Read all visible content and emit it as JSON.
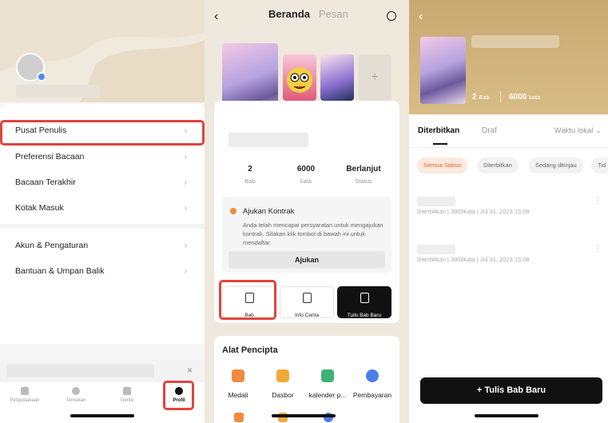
{
  "menu": {
    "items": [
      {
        "label": "Pusat Penulis"
      },
      {
        "label": "Preferensi Bacaan"
      },
      {
        "label": "Bacaan Terakhir"
      },
      {
        "label": "Kotak Masuk"
      },
      {
        "label": "Akun & Pengaturan"
      },
      {
        "label": "Bantuan & Umpan Balik"
      }
    ],
    "chevron": "›"
  },
  "banner": {
    "close": "×"
  },
  "tabbar": {
    "tabs": [
      {
        "label": "Perpustakaan",
        "icon": "library-icon"
      },
      {
        "label": "Temukan",
        "icon": "compass-icon"
      },
      {
        "label": "Genre",
        "icon": "grid-icon"
      },
      {
        "label": "Profil",
        "icon": "person-icon"
      }
    ]
  },
  "book": {
    "nav": {
      "back": "‹",
      "tab_home": "Beranda",
      "tab_msg": "Pesan"
    },
    "add_cover": "+",
    "stats": [
      {
        "value": "2",
        "label": "Bab"
      },
      {
        "value": "6000",
        "label": "kata"
      },
      {
        "value": "Berlanjut",
        "label": "Status"
      }
    ],
    "contract": {
      "title": "Ajukan Kontrak",
      "text": "Anda telah mencapai persyaratan untuk mengajukan kontrak. Silakan klik tombol di bawah ini untuk mendaftar.",
      "button": "Ajukan"
    },
    "actions": [
      {
        "label": "Bab"
      },
      {
        "label": "Info Cerita"
      },
      {
        "label": "Tulis Bab Baru"
      }
    ],
    "tools": {
      "title": "Alat Pencipta",
      "items": [
        {
          "label": "Medali",
          "color": "#f08a3e"
        },
        {
          "label": "Dasbor",
          "color": "#f2a93b"
        },
        {
          "label": "kalender p...",
          "color": "#3cb371"
        },
        {
          "label": "Pembayaran",
          "color": "#4a7fe8"
        }
      ]
    }
  },
  "chapters": {
    "back": "‹",
    "chapters_value": "2",
    "chapters_unit": "Bab",
    "words_value": "6000",
    "words_unit": "kata",
    "tabs": {
      "published": "Diterbitkan",
      "draft": "Draf",
      "sort": "Waktu lokal ⌄"
    },
    "chips": [
      {
        "label": "Semua Status"
      },
      {
        "label": "Diterbitkan"
      },
      {
        "label": "Sedang ditinjau"
      },
      {
        "label": "Tid"
      }
    ],
    "rows": [
      {
        "meta": "Diterbitkan | 3000kata | Jul 31, 2023 15:09"
      },
      {
        "meta": "Diterbitkan | 3000kata | Jul 31, 2023 15:08"
      }
    ],
    "kebab": "⋮",
    "new_button": "+ Tulis Bab Baru"
  }
}
